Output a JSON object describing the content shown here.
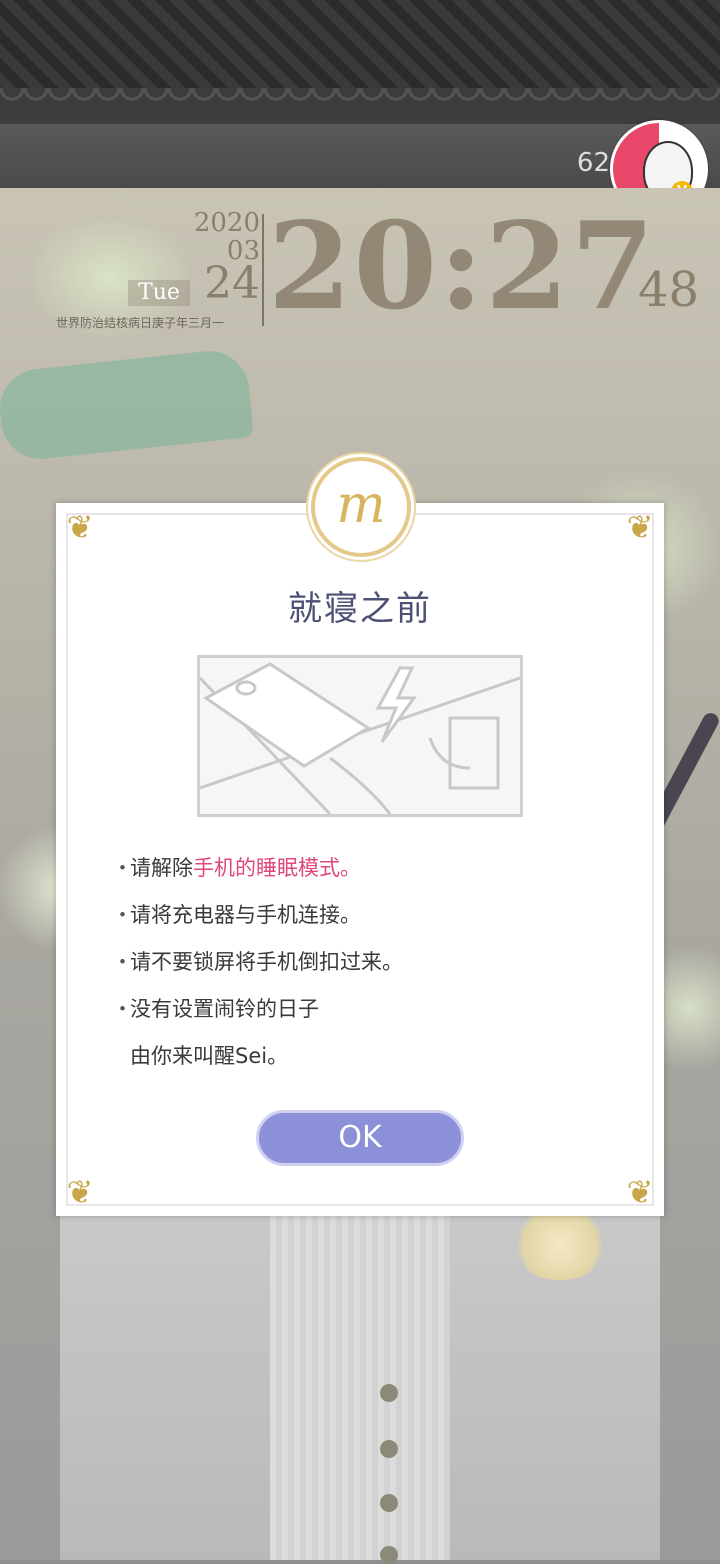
{
  "status": {
    "battery_text": "62"
  },
  "clock": {
    "year": "2020",
    "month": "03",
    "day": "24",
    "weekday": "Tue",
    "holiday": "世界防治结核病日庚子年三月一",
    "time": "20:27",
    "seconds": "48"
  },
  "dialog": {
    "emblem_letter": "m",
    "title": "就寝之前",
    "tips": {
      "t1_prefix": "请解除",
      "t1_highlight": "手机的睡眠模式。",
      "t2": "请将充电器与手机连接。",
      "t3": "请不要锁屏将手机倒扣过来。",
      "t4_line1": "没有设置闹铃的日子",
      "t4_line2": "由你来叫醒Sei。"
    },
    "bullet": "・",
    "ok_label": "OK"
  },
  "colors": {
    "title": "#4d5075",
    "highlight": "#e0477a",
    "ok_button": "#8c90d8",
    "gold": "#caa54a"
  },
  "icons": [
    "avatar-icon",
    "lightning-icon",
    "phone-icon",
    "corner-ornament-icon"
  ]
}
